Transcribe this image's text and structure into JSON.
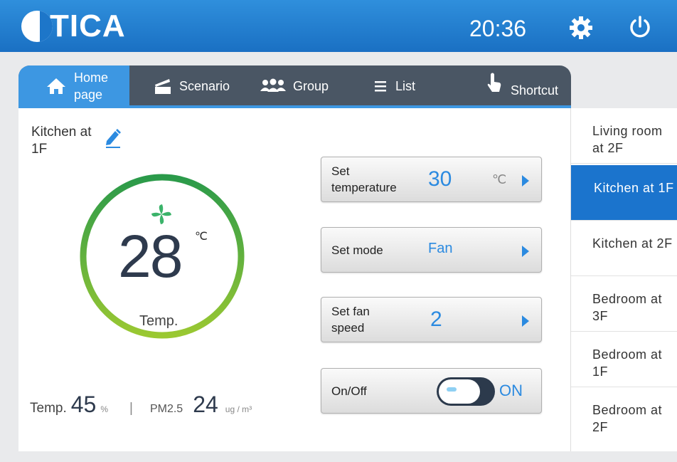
{
  "header": {
    "brand": "TICA",
    "time": "20:36",
    "accent": "#1d76c9"
  },
  "tabs": [
    {
      "label": "Home page",
      "icon": "home-icon",
      "active": true
    },
    {
      "label": "Scenario",
      "icon": "scenario-icon"
    },
    {
      "label": "Group",
      "icon": "group-icon"
    },
    {
      "label": "List",
      "icon": "list-icon"
    },
    {
      "label": "Shortcut",
      "icon": "shortcut-icon"
    }
  ],
  "room": {
    "title": "Kitchen at 1F"
  },
  "gauge": {
    "value": "28",
    "unit": "℃",
    "label": "Temp."
  },
  "stats": {
    "temp_label": "Temp.",
    "humidity": "45",
    "humidity_unit": "%",
    "pm_label": "PM2.5",
    "pm_value": "24",
    "pm_unit": "ug / m³"
  },
  "controls": {
    "set_temperature": {
      "label": "Set temperature",
      "value": "30",
      "unit": "℃"
    },
    "set_mode": {
      "label": "Set mode",
      "value": "Fan"
    },
    "set_fan_speed": {
      "label": "Set fan speed",
      "value": "2"
    },
    "on_off": {
      "label": "On/Off",
      "state": "ON"
    }
  },
  "sidebar": {
    "items": [
      {
        "label": "Living room at 2F"
      },
      {
        "label": "Kitchen at 1F",
        "active": true
      },
      {
        "label": "Kitchen at 2F"
      },
      {
        "label": "Bedroom at 3F"
      },
      {
        "label": "Bedroom at 1F"
      },
      {
        "label": "Bedroom at 2F"
      }
    ]
  }
}
